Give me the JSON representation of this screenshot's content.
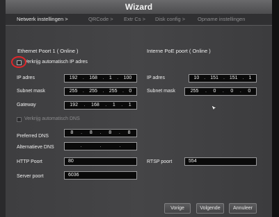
{
  "window": {
    "title": "Wizard"
  },
  "tabs": [
    {
      "label": "Netwerk instellingen >"
    },
    {
      "label": "QRCode >"
    },
    {
      "label": "Extr Cs >"
    },
    {
      "label": "Disk config >"
    },
    {
      "label": "Opname instellingen"
    }
  ],
  "ethernet": {
    "title": "Ethernet Poort 1 ( Online )",
    "auto_ip_label": "Verkrijg automatisch IP adres",
    "ip_label": "IP adres",
    "ip": [
      "192",
      "168",
      "1",
      "100"
    ],
    "subnet_label": "Subnet mask",
    "subnet": [
      "255",
      "255",
      "255",
      "0"
    ],
    "gateway_label": "Gateway",
    "gateway": [
      "192",
      "168",
      "1",
      "1"
    ],
    "auto_dns_label": "Verkrijg automatisch DNS",
    "pref_dns_label": "Preferred DNS",
    "pref_dns": [
      "8",
      "8",
      "8",
      "8"
    ],
    "alt_dns_label": "Alternatieve DNS",
    "alt_dns": [
      "",
      "",
      "",
      ""
    ]
  },
  "poe": {
    "title": "Interne PoE poort ( Online )",
    "ip_label": "IP adres",
    "ip": [
      "10",
      "151",
      "151",
      "1"
    ],
    "subnet_label": "Subnet mask",
    "subnet": [
      "255",
      "0",
      "0",
      "0"
    ]
  },
  "ports": {
    "http_label": "HTTP Poort",
    "http_value": "80",
    "rtsp_label": "RTSP poort",
    "rtsp_value": "554",
    "server_label": "Server poort",
    "server_value": "6036"
  },
  "buttons": {
    "prev": "Vorige",
    "next": "Volgende",
    "cancel": "Annuleer"
  },
  "colors": {
    "annotation_circle": "#e0262a",
    "field_background": "#0a0a0a",
    "panel_background": "#414143"
  }
}
